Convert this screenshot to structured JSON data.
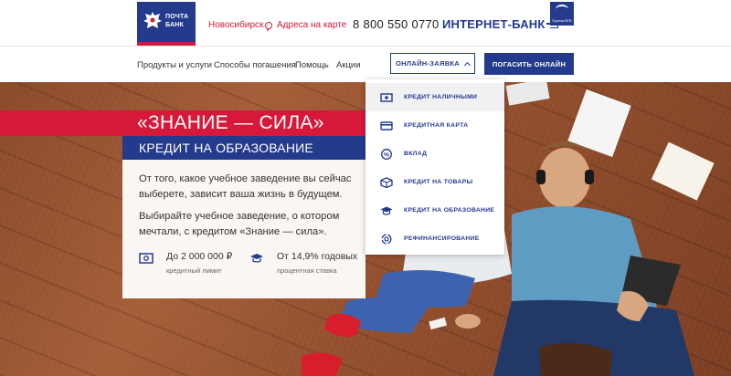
{
  "header": {
    "logo_text": "ПОЧТА БАНК",
    "city": "Новосибирск",
    "map_link": "Адреса на карте",
    "phone": "8 800 550 0770",
    "internet_bank": "ИНТЕРНЕТ-БАНК",
    "group_badge": "Группа ВТБ"
  },
  "nav": {
    "items": [
      "Продукты и услуги",
      "Способы погашения",
      "Помощь",
      "Акции"
    ],
    "apply_button": "ОНЛАЙН-ЗАЯВКА",
    "pay_button": "ПОГАСИТЬ ОНЛАЙН"
  },
  "dropdown": {
    "items": [
      {
        "label": "КРЕДИТ НАЛИЧНЫМИ",
        "icon": "cash-icon"
      },
      {
        "label": "КРЕДИТНАЯ КАРТА",
        "icon": "card-icon"
      },
      {
        "label": "ВКЛАД",
        "icon": "percent-icon"
      },
      {
        "label": "КРЕДИТ НА ТОВАРЫ",
        "icon": "box-icon"
      },
      {
        "label": "КРЕДИТ НА ОБРАЗОВАНИЕ",
        "icon": "graduation-cap-icon"
      },
      {
        "label": "РЕФИНАНСИРОВАНИЕ",
        "icon": "refinance-icon"
      }
    ]
  },
  "hero": {
    "title": "«ЗНАНИЕ — СИЛА»",
    "subtitle": "КРЕДИТ НА ОБРАЗОВАНИЕ",
    "paragraph1": "От того, какое учебное заведение вы сейчас выберете, зависит ваша жизнь в будущем.",
    "paragraph2": "Выбирайте учебное заведение, о котором мечтали, с кредитом «Знание — сила».",
    "stats": [
      {
        "value": "До 2 000 000 ₽",
        "caption": "кредитный лимит",
        "icon": "money-icon"
      },
      {
        "value": "От 14,9% годовых",
        "caption": "процентная ставка",
        "icon": "graduation-cap-icon"
      }
    ]
  },
  "colors": {
    "brand_blue": "#243a8c",
    "brand_red": "#d6193a"
  }
}
